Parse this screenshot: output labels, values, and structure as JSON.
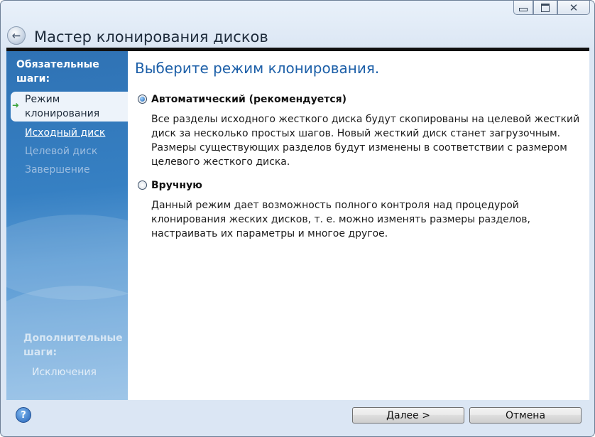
{
  "window": {
    "title": "Мастер клонирования дисков",
    "controls": {
      "minimize": "",
      "maximize": "",
      "close": "✕"
    }
  },
  "sidebar": {
    "required_heading": "Обязательные шаги:",
    "steps": [
      {
        "label": "Режим клонирования",
        "state": "current"
      },
      {
        "label": "Исходный диск",
        "state": "link"
      },
      {
        "label": "Целевой диск",
        "state": "disabled"
      },
      {
        "label": "Завершение",
        "state": "disabled"
      }
    ],
    "optional_heading": "Дополнительные шаги:",
    "optional_items": [
      "Исключения"
    ]
  },
  "main": {
    "heading": "Выберите режим клонирования.",
    "options": [
      {
        "label": "Автоматический (рекомендуется)",
        "selected": true,
        "description": "Все разделы исходного жесткого диска будут скопированы на целевой жесткий диск за несколько простых шагов. Новый жесткий диск станет загрузочным. Размеры существующих разделов будут изменены в соответствии с размером целевого жесткого диска."
      },
      {
        "label": "Вручную",
        "selected": false,
        "description": "Данный режим дает возможность полного контроля над процедурой клонирования жеских дисков, т. е. можно изменять размеры разделов, настраивать их параметры и многое другое."
      }
    ]
  },
  "footer": {
    "help_glyph": "?",
    "next_label": "Далее >",
    "cancel_label": "Отмена"
  },
  "colors": {
    "accent": "#1c5fa8",
    "sidebar_top": "#2f72b4",
    "sidebar_bottom": "#8fbde5"
  },
  "icons": [
    "back-arrow-icon",
    "current-step-arrow-icon",
    "help-icon",
    "minimize-icon",
    "maximize-icon",
    "close-icon"
  ]
}
